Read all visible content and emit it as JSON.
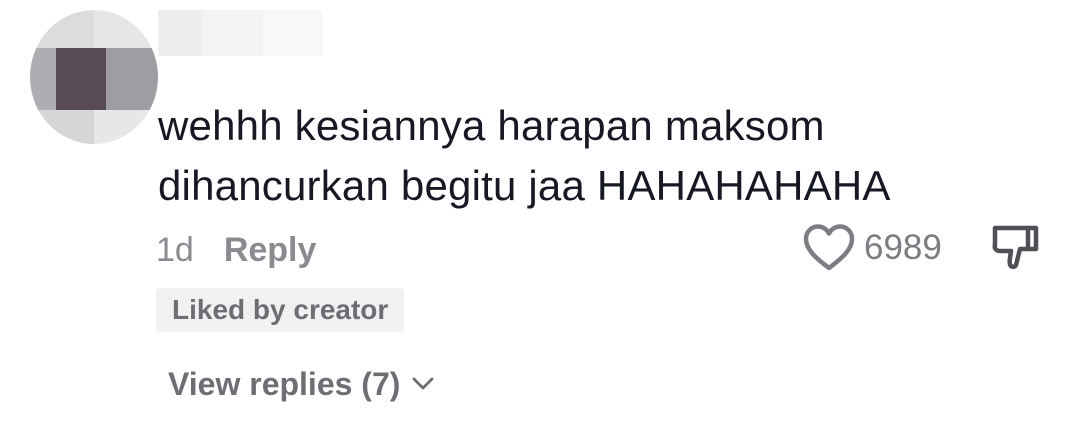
{
  "comment": {
    "text_lines": [
      "wehhh kesiannya harapan maksom",
      "dihancurkan begitu jaa HAHAHAHAHA"
    ],
    "time": "1d",
    "reply_label": "Reply",
    "like_count": "6989",
    "liked_by_creator_label": "Liked by creator",
    "view_replies_label": "View replies (7)"
  },
  "icons": {
    "like": "heart-outline-icon",
    "dislike": "thumbs-down-icon",
    "expand": "chevron-down-icon"
  },
  "colors": {
    "text_primary": "#161823",
    "text_secondary": "#8a8b91",
    "badge_bg": "#f1f1f2",
    "badge_text": "#6d6e73",
    "avatar_dark": "#584b55",
    "avatar_mid": "#9e9ea2",
    "avatar_light": "#e0e0e2"
  }
}
